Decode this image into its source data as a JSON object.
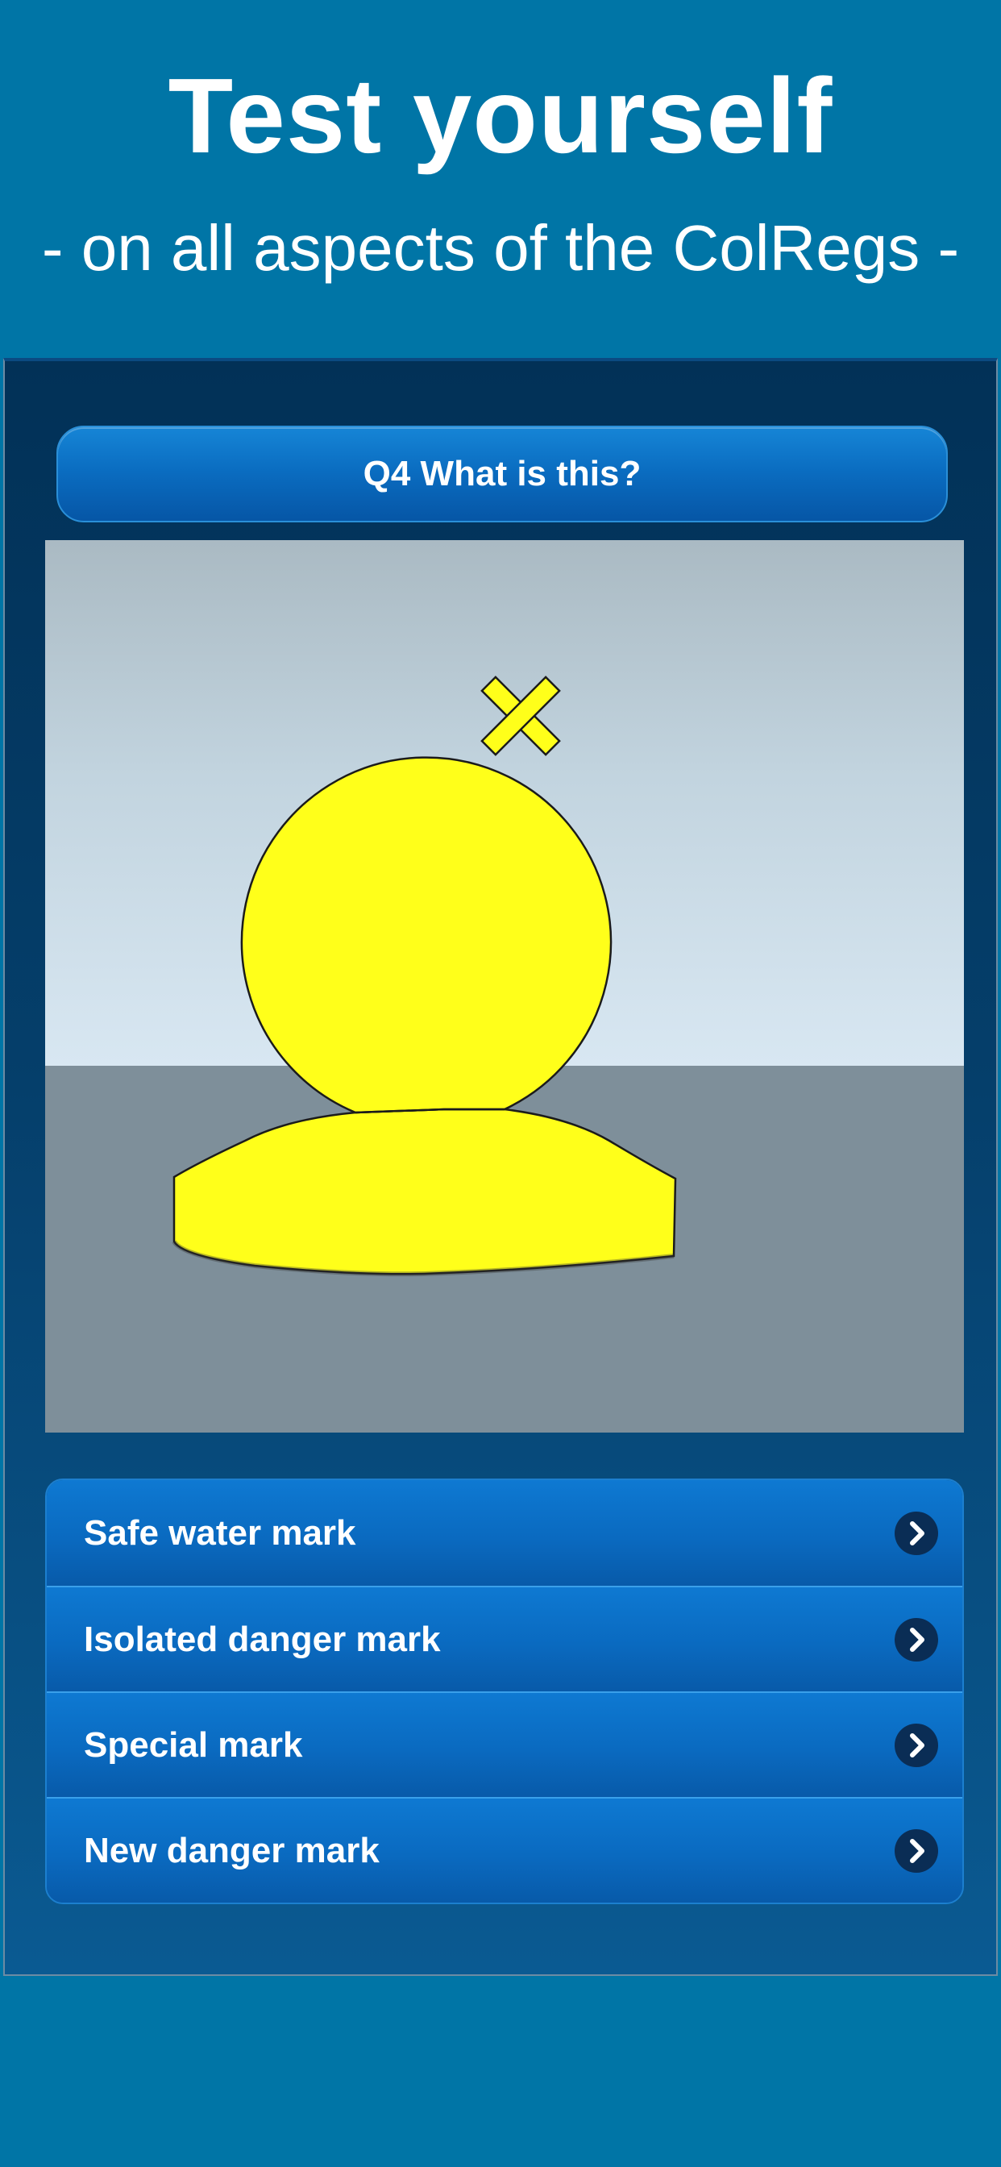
{
  "promo": {
    "title": "Test yourself",
    "subtitle": "- on all aspects of the ColRegs -"
  },
  "quiz": {
    "question": "Q4 What is this?",
    "image_icon": "yellow-special-mark-buoy-with-x-topmark",
    "answers": [
      {
        "label": "Safe water mark",
        "icon": "chevron-right-icon"
      },
      {
        "label": "Isolated danger mark",
        "icon": "chevron-right-icon"
      },
      {
        "label": "Special mark",
        "icon": "chevron-right-icon"
      },
      {
        "label": "New danger mark",
        "icon": "chevron-right-icon"
      }
    ]
  },
  "colors": {
    "background": "#0075a6",
    "panel": "#043a64",
    "button_blue": "#0a6cc0",
    "buoy_yellow": "#ffff1a",
    "sky": "#c7dbe8",
    "sea": "#7e8f9a"
  }
}
